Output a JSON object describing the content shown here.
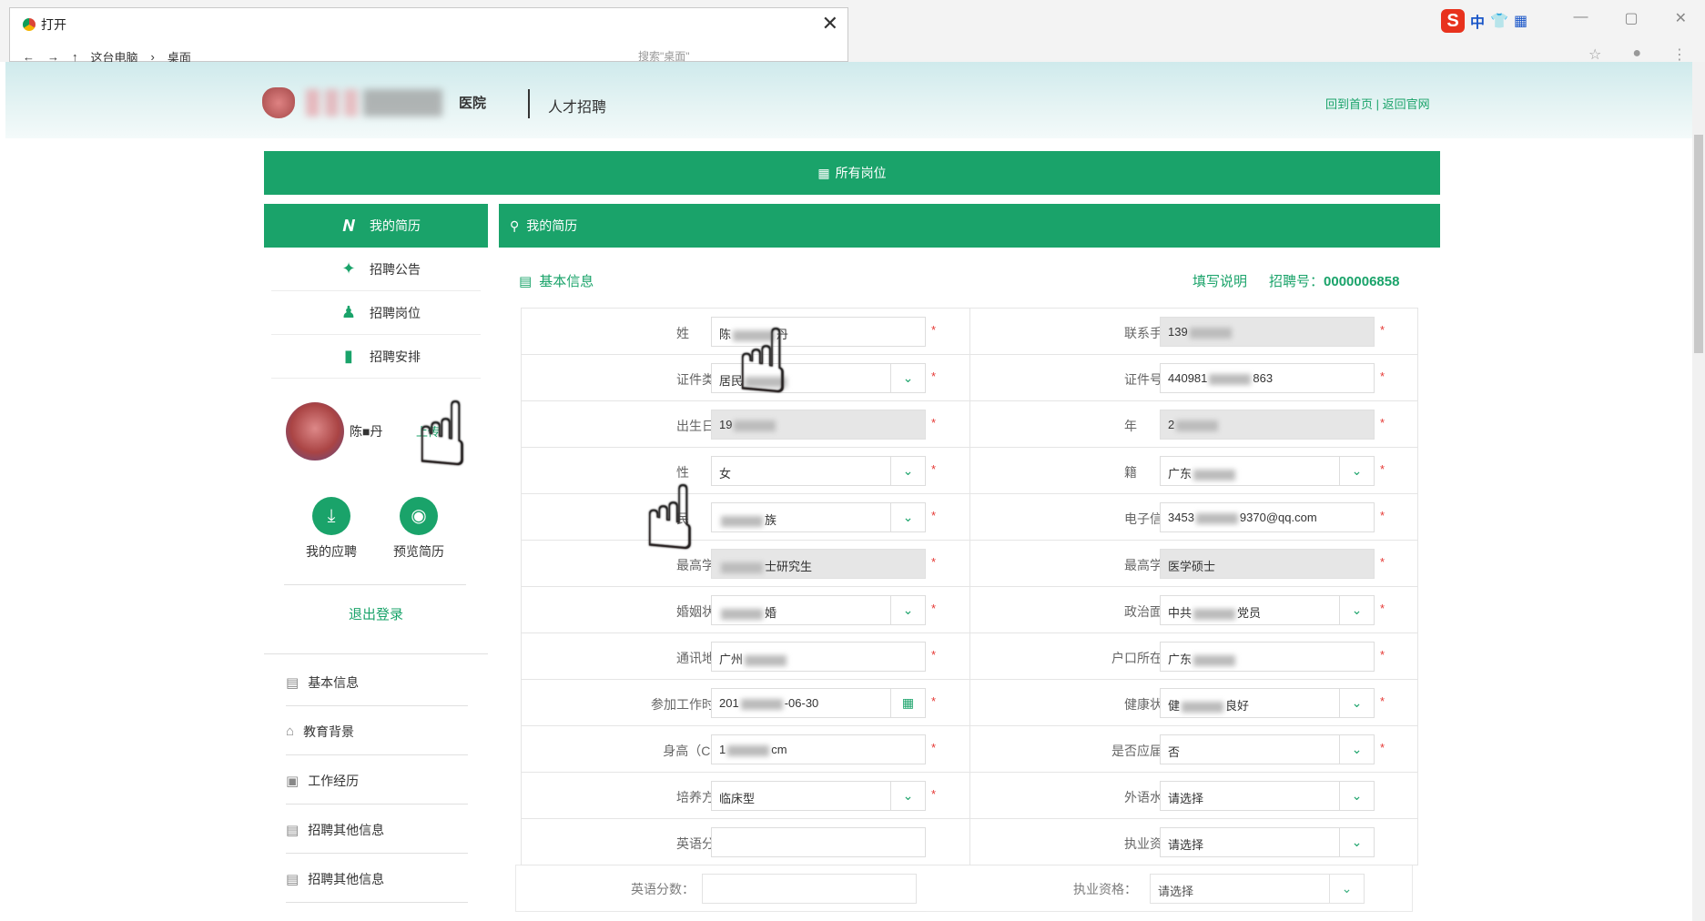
{
  "chrome": {
    "explorer_title": "打开",
    "breadcrumb": [
      "这台电脑",
      "桌面"
    ],
    "search_placeholder": "搜索\"桌面\"",
    "ime": [
      "中"
    ]
  },
  "header": {
    "hospital": "医院",
    "title": "人才招聘",
    "links": "回到首页 | 返回官网"
  },
  "nav": {
    "all_positions": "所有岗位"
  },
  "section": {
    "title": "我的简历"
  },
  "sidebar": {
    "items": [
      {
        "label": "我的简历",
        "icon": "resume-icon"
      },
      {
        "label": "招聘公告",
        "icon": "megaphone-icon"
      },
      {
        "label": "招聘岗位",
        "icon": "person-icon"
      },
      {
        "label": "招聘安排",
        "icon": "bookmark-icon"
      }
    ],
    "profile_name": "陈■丹",
    "upload": "上传",
    "actions": [
      {
        "label": "我的应聘",
        "icon": "download-icon"
      },
      {
        "label": "预览简历",
        "icon": "eye-icon"
      }
    ],
    "logout": "退出登录",
    "sub_nav": [
      "基本信息",
      "教育背景",
      "工作经历",
      "招聘其他信息",
      "招聘其他信息"
    ]
  },
  "form": {
    "section_title": "基本信息",
    "instructions": "填写说明",
    "recruit_no_label": "招聘号：",
    "recruit_no": "0000006858",
    "rows": [
      {
        "left": {
          "label": "姓　　名：",
          "value": "陈■丹",
          "type": "text"
        },
        "right": {
          "label": "联系手机：",
          "value": "139■■■■■",
          "type": "readonly"
        }
      },
      {
        "left": {
          "label": "证件类型：",
          "value": "居民■",
          "type": "select"
        },
        "right": {
          "label": "证件号码：",
          "value": "440981■■■■■■863",
          "type": "text"
        }
      },
      {
        "left": {
          "label": "出生日期：",
          "value": "19■■",
          "type": "readonly"
        },
        "right": {
          "label": "年　　龄：",
          "value": "2■",
          "type": "readonly"
        }
      },
      {
        "left": {
          "label": "性　　别：",
          "value": "女",
          "type": "select"
        },
        "right": {
          "label": "籍　　贯：",
          "value": "广东■■■",
          "type": "select"
        }
      },
      {
        "left": {
          "label": "民　　族：",
          "value": "■族",
          "type": "select"
        },
        "right": {
          "label": "电子信箱：",
          "value": "3453■■9370@qq.com",
          "type": "text"
        }
      },
      {
        "left": {
          "label": "最高学历：",
          "value": "■士研究生",
          "type": "readonly"
        },
        "right": {
          "label": "最高学位：",
          "value": "医学硕士",
          "type": "readonly"
        }
      },
      {
        "left": {
          "label": "婚姻状况：",
          "value": "■婚",
          "type": "select"
        },
        "right": {
          "label": "政治面貌：",
          "value": "中共■■党员",
          "type": "select"
        }
      },
      {
        "left": {
          "label": "通讯地址：",
          "value": "广州■■■",
          "type": "text"
        },
        "right": {
          "label": "户口所在地：",
          "value": "广东■■",
          "type": "text"
        }
      },
      {
        "left": {
          "label": "参加工作时间：",
          "value": "201■-06-30",
          "type": "date"
        },
        "right": {
          "label": "健康状况：",
          "value": "健■良好",
          "type": "select"
        }
      },
      {
        "left": {
          "label": "身高（CM）：",
          "value": "1■■cm",
          "type": "text"
        },
        "right": {
          "label": "是否应届生：",
          "value": "否",
          "type": "select"
        }
      },
      {
        "left": {
          "label": "培养方式：",
          "value": "临床型",
          "type": "select"
        },
        "right": {
          "label": "外语水平：",
          "value": "请选择",
          "type": "select",
          "optional": true
        }
      },
      {
        "left": {
          "label": "英语分数：",
          "value": "",
          "type": "text",
          "optional": true
        },
        "right": {
          "label": "执业资格：",
          "value": "请选择",
          "type": "select",
          "optional": true
        }
      }
    ],
    "ghost_row": {
      "left_label": "英语分数：",
      "right_label": "执业资格：",
      "right_value": "请选择"
    }
  },
  "colors": {
    "accent": "#1aa36a",
    "required": "#e53935"
  }
}
